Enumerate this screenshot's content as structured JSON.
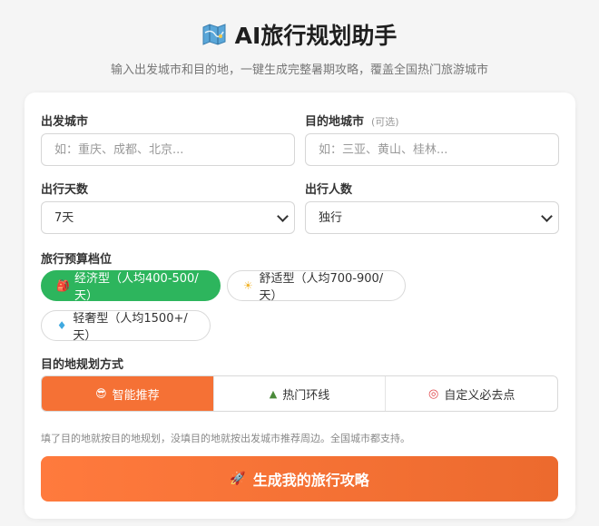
{
  "header": {
    "icon": "map-icon",
    "title": "AI旅行规划助手",
    "subtitle": "输入出发城市和目的地，一键生成完整暑期攻略，覆盖全国热门旅游城市"
  },
  "form": {
    "departure": {
      "label": "出发城市",
      "placeholder": "如：重庆、成都、北京..."
    },
    "destination": {
      "label": "目的地城市",
      "optional": "(可选)",
      "placeholder": "如：三亚、黄山、桂林..."
    },
    "days": {
      "label": "出行天数",
      "value": "7天"
    },
    "people": {
      "label": "出行人数",
      "value": "独行"
    },
    "budget": {
      "label": "旅行预算档位",
      "options": [
        {
          "icon": "backpack-icon",
          "glyph": "🎒",
          "label": "经济型（人均400-500/天）",
          "active": true
        },
        {
          "icon": "sun-icon",
          "glyph": "☀",
          "label": "舒适型（人均700-900/天）",
          "active": false
        },
        {
          "icon": "diamond-icon",
          "glyph": "♦",
          "label": "轻奢型（人均1500+/天）",
          "active": false
        }
      ]
    },
    "mode": {
      "label": "目的地规划方式",
      "options": [
        {
          "icon": "sunglasses-icon",
          "glyph": "😎",
          "label": "智能推荐",
          "active": true
        },
        {
          "icon": "mountain-icon",
          "glyph": "▲",
          "label": "热门环线",
          "active": false
        },
        {
          "icon": "target-icon",
          "glyph": "◎",
          "label": "自定义必去点",
          "active": false
        }
      ]
    },
    "hint": "填了目的地就按目的地规划，没填目的地就按出发城市推荐周边。全国城市都支持。",
    "submit": {
      "icon": "rocket-icon",
      "glyph": "🚀",
      "label": "生成我的旅行攻略"
    }
  },
  "colors": {
    "accent": "#f57135",
    "budget_active": "#2db55d",
    "background": "#f5f5f5"
  }
}
